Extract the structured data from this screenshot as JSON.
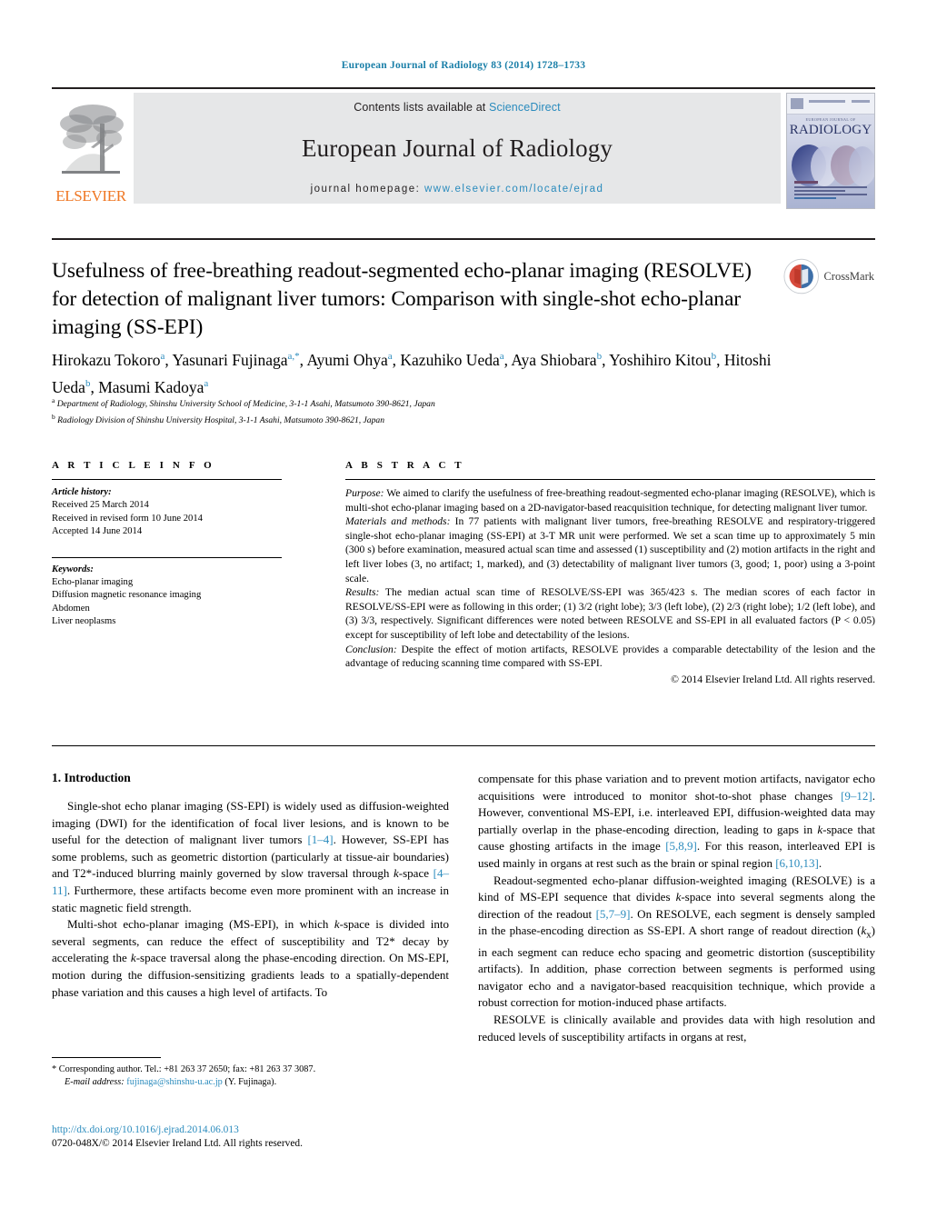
{
  "running_head": "European Journal of Radiology 83 (2014) 1728–1733",
  "masthead": {
    "publisher_name": "ELSEVIER",
    "contents_prefix": "Contents lists available at ",
    "contents_brand": "ScienceDirect",
    "journal_title": "European Journal of Radiology",
    "homepage_label": "journal homepage: ",
    "homepage_url": "www.elsevier.com/locate/ejrad",
    "cover": {
      "supertitle": "EUROPEAN JOURNAL OF",
      "title": "RADIOLOGY"
    },
    "brand_color": "#2a8bbd",
    "elsevier_orange": "#ef7622"
  },
  "article": {
    "title": "Usefulness of free-breathing readout-segmented echo-planar imaging (RESOLVE) for detection of malignant liver tumors: Comparison with single-shot echo-planar imaging (SS-EPI)",
    "crossmark_label": "CrossMark",
    "authors_line1": "Hirokazu Tokoro",
    "authors": [
      {
        "name": "Hirokazu Tokoro",
        "sup": "a",
        "corresponding": false
      },
      {
        "name": "Yasunari Fujinaga",
        "sup": "a,",
        "corresponding": true
      },
      {
        "name": "Ayumi Ohya",
        "sup": "a",
        "corresponding": false
      },
      {
        "name": "Kazuhiko Ueda",
        "sup": "a",
        "corresponding": false
      },
      {
        "name": "Aya Shiobara",
        "sup": "b",
        "corresponding": false
      },
      {
        "name": "Yoshihiro Kitou",
        "sup": "b",
        "corresponding": false
      },
      {
        "name": "Hitoshi Ueda",
        "sup": "b",
        "corresponding": false
      },
      {
        "name": "Masumi Kadoya",
        "sup": "a",
        "corresponding": false
      }
    ],
    "affiliations": [
      {
        "marker": "a",
        "text": "Department of Radiology, Shinshu University School of Medicine, 3-1-1 Asahi, Matsumoto 390-8621, Japan"
      },
      {
        "marker": "b",
        "text": "Radiology Division of Shinshu University Hospital, 3-1-1 Asahi, Matsumoto 390-8621, Japan"
      }
    ]
  },
  "article_info": {
    "heading": "A R T I C L E    I N F O",
    "history_label": "Article history:",
    "history": [
      "Received 25 March 2014",
      "Received in revised form 10 June 2014",
      "Accepted 14 June 2014"
    ],
    "keywords_label": "Keywords:",
    "keywords": [
      "Echo-planar imaging",
      "Diffusion magnetic resonance imaging",
      "Abdomen",
      "Liver neoplasms"
    ]
  },
  "abstract": {
    "heading": "A B S T R A C T",
    "sections": [
      {
        "label": "Purpose:",
        "text": " We aimed to clarify the usefulness of free-breathing readout-segmented echo-planar imaging (RESOLVE), which is multi-shot echo-planar imaging based on a 2D-navigator-based reacquisition technique, for detecting malignant liver tumor."
      },
      {
        "label": "Materials and methods:",
        "text": " In 77 patients with malignant liver tumors, free-breathing RESOLVE and respiratory-triggered single-shot echo-planar imaging (SS-EPI) at 3-T MR unit were performed. We set a scan time up to approximately 5 min (300 s) before examination, measured actual scan time and assessed (1) susceptibility and (2) motion artifacts in the right and left liver lobes (3, no artifact; 1, marked), and (3) detectability of malignant liver tumors (3, good; 1, poor) using a 3-point scale."
      },
      {
        "label": "Results:",
        "text": " The median actual scan time of RESOLVE/SS-EPI was 365/423 s. The median scores of each factor in RESOLVE/SS-EPI were as following in this order; (1) 3/2 (right lobe); 3/3 (left lobe), (2) 2/3 (right lobe); 1/2 (left lobe), and (3) 3/3, respectively. Significant differences were noted between RESOLVE and SS-EPI in all evaluated factors (P < 0.05) except for susceptibility of left lobe and detectability of the lesions."
      },
      {
        "label": "Conclusion:",
        "text": " Despite the effect of motion artifacts, RESOLVE provides a comparable detectability of the lesion and the advantage of reducing scanning time compared with SS-EPI."
      }
    ],
    "copyright": "© 2014 Elsevier Ireland Ltd. All rights reserved."
  },
  "introduction": {
    "heading": "1.  Introduction",
    "left_paragraphs": [
      {
        "parts": [
          {
            "t": "Single-shot echo planar imaging (SS-EPI) is widely used as diffusion-weighted imaging (DWI) for the identification of focal liver lesions, and is known to be useful for the detection of malignant liver tumors ",
            "k": "plain"
          },
          {
            "t": "[1–4]",
            "k": "ref"
          },
          {
            "t": ". However, SS-EPI has some problems, such as geometric distortion (particularly at tissue-air boundaries) and T2*-induced blurring mainly governed by slow traversal through ",
            "k": "plain"
          },
          {
            "t": "k",
            "k": "ital"
          },
          {
            "t": "-space ",
            "k": "plain"
          },
          {
            "t": "[4–11]",
            "k": "ref"
          },
          {
            "t": ". Furthermore, these artifacts become even more prominent with an increase in static magnetic field strength.",
            "k": "plain"
          }
        ]
      },
      {
        "parts": [
          {
            "t": "Multi-shot echo-planar imaging (MS-EPI), in which ",
            "k": "plain"
          },
          {
            "t": "k",
            "k": "ital"
          },
          {
            "t": "-space is divided into several segments, can reduce the effect of susceptibility and T2* decay by accelerating the ",
            "k": "plain"
          },
          {
            "t": "k",
            "k": "ital"
          },
          {
            "t": "-space traversal along the phase-encoding direction. On MS-EPI, motion during the diffusion-sensitizing gradients leads to a spatially-dependent phase variation and this causes a high level of artifacts. To",
            "k": "plain"
          }
        ]
      }
    ],
    "right_paragraphs": [
      {
        "indent": false,
        "parts": [
          {
            "t": "compensate for this phase variation and to prevent motion artifacts, navigator echo acquisitions were introduced to monitor shot-to-shot phase changes ",
            "k": "plain"
          },
          {
            "t": "[9–12]",
            "k": "ref"
          },
          {
            "t": ". However, conventional MS-EPI, i.e. interleaved EPI, diffusion-weighted data may partially overlap in the phase-encoding direction, leading to gaps in ",
            "k": "plain"
          },
          {
            "t": "k",
            "k": "ital"
          },
          {
            "t": "-space that cause ghosting artifacts in the image ",
            "k": "plain"
          },
          {
            "t": "[5,8,9]",
            "k": "ref"
          },
          {
            "t": ". For this reason, interleaved EPI is used mainly in organs at rest such as the brain or spinal region ",
            "k": "plain"
          },
          {
            "t": "[6,10,13]",
            "k": "ref"
          },
          {
            "t": ".",
            "k": "plain"
          }
        ]
      },
      {
        "indent": true,
        "parts": [
          {
            "t": "Readout-segmented echo-planar diffusion-weighted imaging (RESOLVE) is a kind of MS-EPI sequence that divides ",
            "k": "plain"
          },
          {
            "t": "k",
            "k": "ital"
          },
          {
            "t": "-space into several segments along the direction of the readout ",
            "k": "plain"
          },
          {
            "t": "[5,7–9]",
            "k": "ref"
          },
          {
            "t": ". On RESOLVE, each segment is densely sampled in the phase-encoding direction as SS-EPI. A short range of readout direction (",
            "k": "plain"
          },
          {
            "t": "k",
            "k": "ital"
          },
          {
            "t": "x",
            "k": "sub"
          },
          {
            "t": ") in each segment can reduce echo spacing and geometric distortion (susceptibility artifacts). In addition, phase correction between segments is performed using navigator echo and a navigator-based reacquisition technique, which provide a robust correction for motion-induced phase artifacts.",
            "k": "plain"
          }
        ]
      },
      {
        "indent": true,
        "parts": [
          {
            "t": "RESOLVE is clinically available and provides data with high resolution and reduced levels of susceptibility artifacts in organs at rest,",
            "k": "plain"
          }
        ]
      }
    ]
  },
  "footnote": {
    "marker": "*",
    "corresponding_text": "Corresponding author. Tel.: +81 263 37 2650; fax: +81 263 37 3087.",
    "email_label": "E-mail address:",
    "email": "fujinaga@shinshu-u.ac.jp",
    "email_suffix": "(Y. Fujinaga)."
  },
  "publication": {
    "doi": "http://dx.doi.org/10.1016/j.ejrad.2014.06.013",
    "issn_line": "0720-048X/© 2014 Elsevier Ireland Ltd. All rights reserved."
  }
}
